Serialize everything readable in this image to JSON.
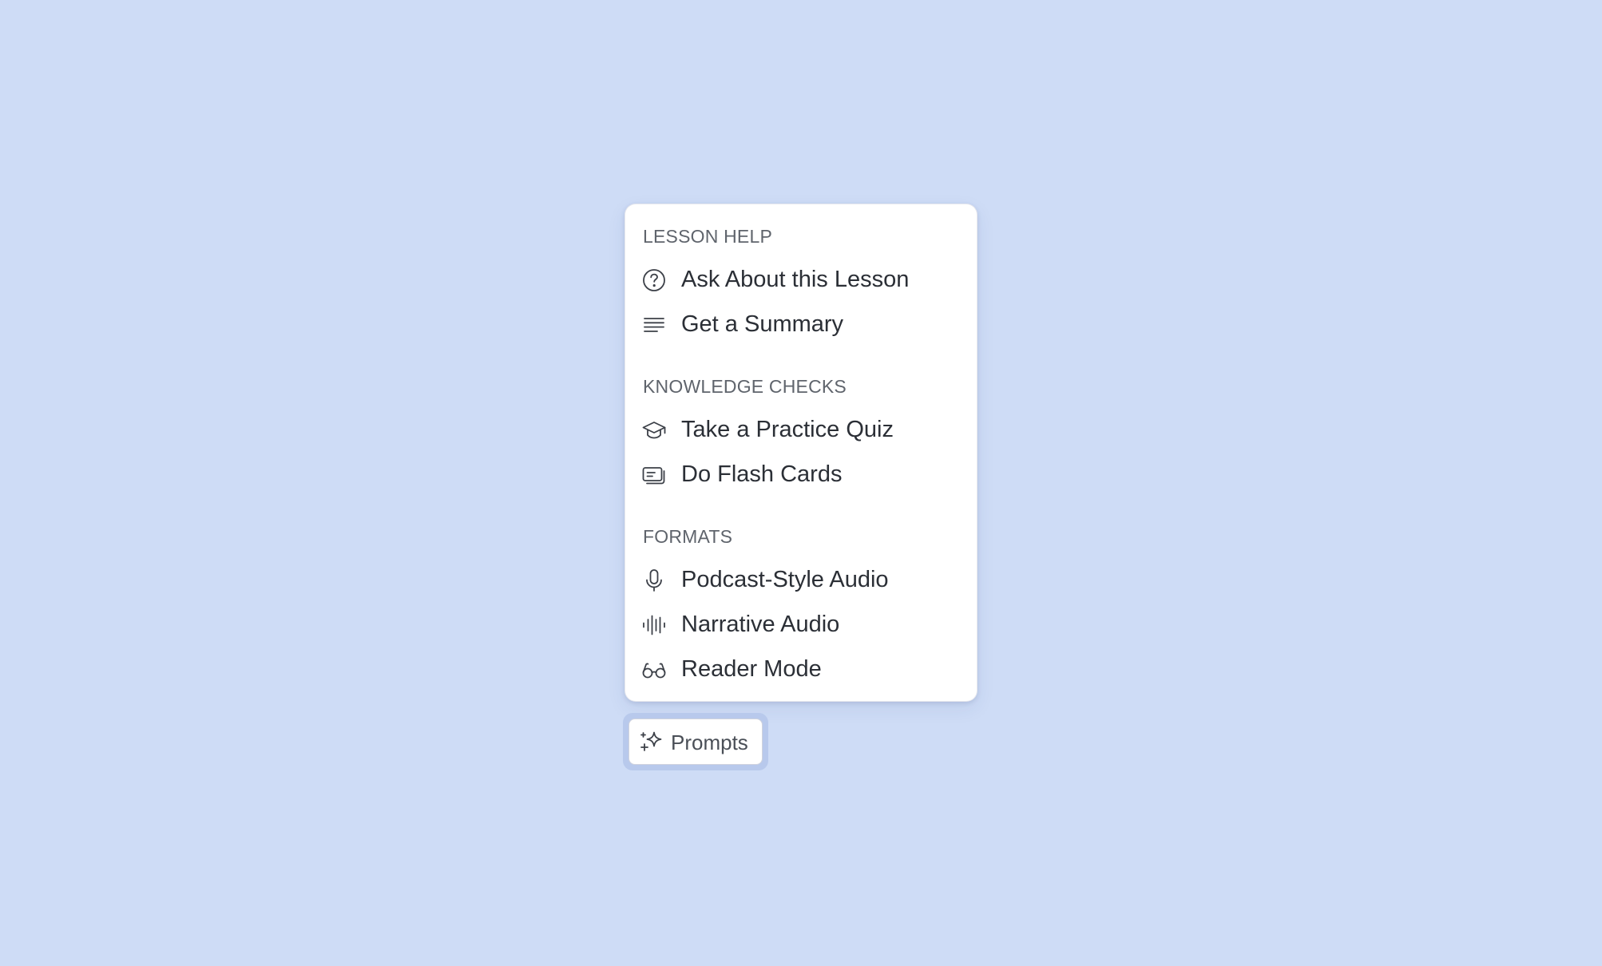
{
  "background_color": "#cedcf6",
  "menu": {
    "sections": [
      {
        "label": "LESSON HELP",
        "items": [
          {
            "label": "Ask About this Lesson",
            "icon": "question-circle-icon"
          },
          {
            "label": "Get a Summary",
            "icon": "text-lines-icon"
          }
        ]
      },
      {
        "label": "KNOWLEDGE CHECKS",
        "items": [
          {
            "label": "Take a Practice Quiz",
            "icon": "graduation-cap-icon"
          },
          {
            "label": "Do Flash Cards",
            "icon": "flash-cards-icon"
          }
        ]
      },
      {
        "label": "FORMATS",
        "items": [
          {
            "label": "Podcast-Style Audio",
            "icon": "microphone-icon"
          },
          {
            "label": "Narrative Audio",
            "icon": "audio-waveform-icon"
          },
          {
            "label": "Reader Mode",
            "icon": "glasses-icon"
          }
        ]
      }
    ]
  },
  "prompts_button": {
    "label": "Prompts",
    "icon": "sparkles-icon"
  }
}
